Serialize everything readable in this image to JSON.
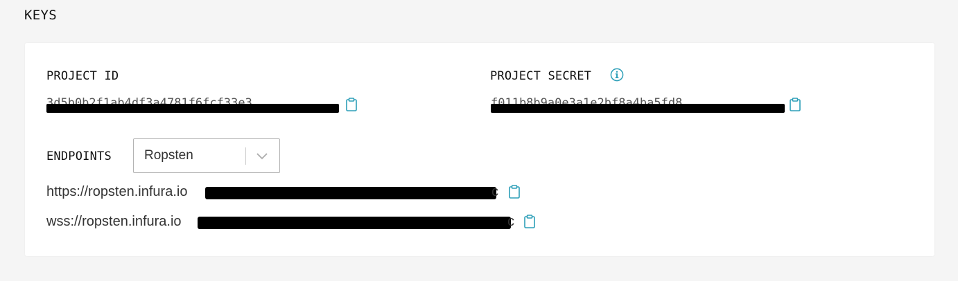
{
  "page": {
    "section_title": "KEYS"
  },
  "keys": {
    "project_id": {
      "label": "PROJECT ID",
      "value_redacted": "3d5b0b2f1ab4df3a4781f6fcf33e3"
    },
    "project_secret": {
      "label": "PROJECT SECRET",
      "value_redacted": "f011b8b9a0e3a1e2bf8a4ba5fd8"
    }
  },
  "endpoints": {
    "label": "ENDPOINTS",
    "network_select": {
      "selected": "Ropsten"
    },
    "https": {
      "prefix": "https://ropsten.infura.io",
      "suffix": "c"
    },
    "wss": {
      "prefix": "wss://ropsten.infura.io",
      "suffix": "c"
    }
  },
  "colors": {
    "accent": "#2d9fb8",
    "background": "#f5f5f5",
    "card": "#ffffff",
    "redaction": "#000000"
  },
  "icons": {
    "copy": "clipboard-icon",
    "info": "info-icon",
    "dropdown": "chevron-down-icon"
  }
}
